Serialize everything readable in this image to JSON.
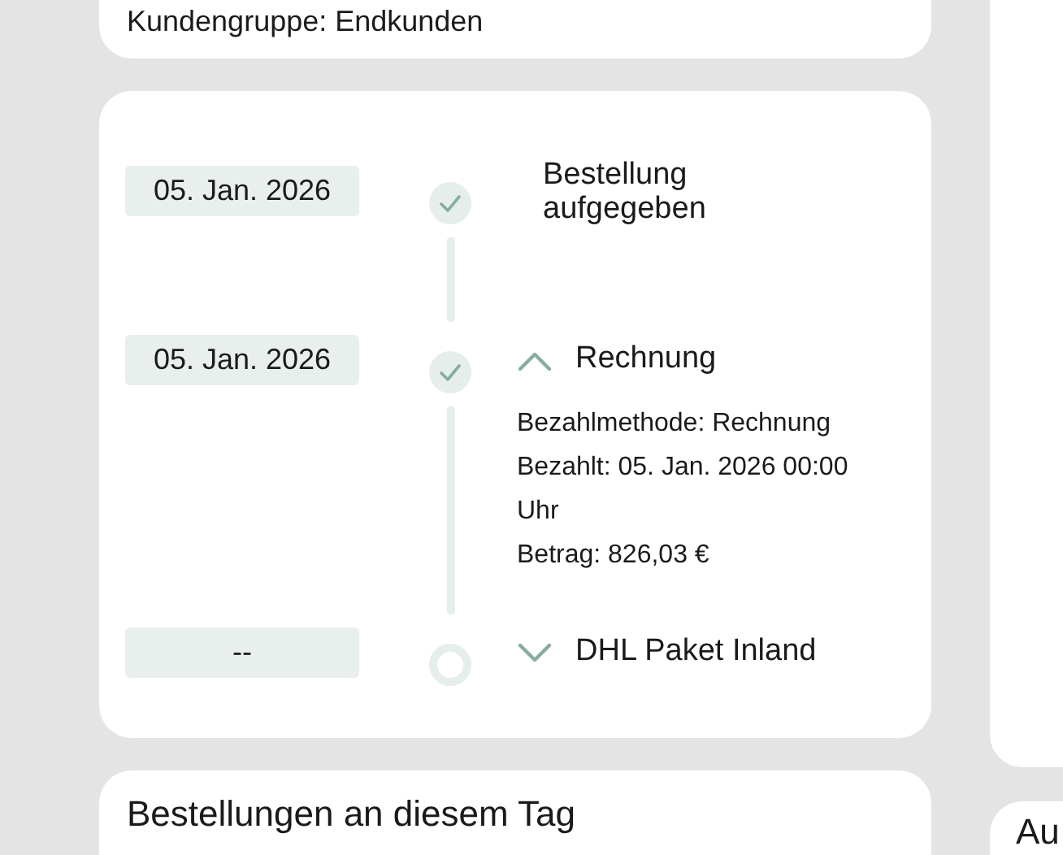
{
  "top_card": {
    "text": "Kundengruppe: Endkunden"
  },
  "timeline": [
    {
      "date": "05. Jan. 2026",
      "done": true,
      "kind": "plain",
      "title": "Bestellung aufgegeben"
    },
    {
      "date": "05. Jan. 2026",
      "done": true,
      "kind": "expandable",
      "expanded": true,
      "title": "Rechnung",
      "details": [
        "Bezahlmethode: Rechnung",
        "Bezahlt: 05. Jan. 2026 00:00 Uhr",
        "Betrag: 826,03 €"
      ]
    },
    {
      "date": "--",
      "done": false,
      "kind": "expandable",
      "expanded": false,
      "title": "DHL Paket Inland"
    }
  ],
  "orders_card": {
    "title": "Bestellungen an diesem Tag"
  },
  "side_card": {
    "title": "Au"
  }
}
